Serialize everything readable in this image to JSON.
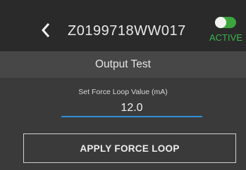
{
  "header": {
    "back_icon": "chevron-left-icon",
    "device_id": "Z0199718WW017",
    "status_label": "ACTIVE",
    "status_color": "#39b54a",
    "toggle_on": true
  },
  "section": {
    "title": "Output Test"
  },
  "force_loop": {
    "label": "Set Force Loop Value (mA)",
    "value": "12.0",
    "apply_label": "APPLY FORCE LOOP"
  },
  "colors": {
    "accent": "#2e8fd6",
    "header_bg": "#2a2a2a",
    "body_bg": "#3a3a3a"
  }
}
